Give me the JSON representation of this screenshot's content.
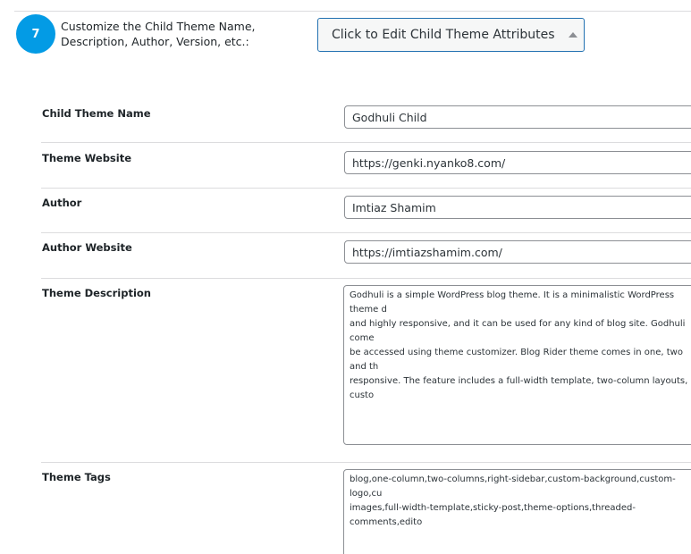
{
  "step": {
    "number": "7",
    "title": "Customize the Child Theme Name, Description, Author, Version, etc.:"
  },
  "toggle_button": {
    "label": "Click to Edit Child Theme Attributes",
    "icon": "caret-up-icon"
  },
  "fields": {
    "child_theme_name": {
      "label": "Child Theme Name",
      "value": "Godhuli Child"
    },
    "theme_website": {
      "label": "Theme Website",
      "value": "https://genki.nyanko8.com/"
    },
    "author": {
      "label": "Author",
      "value": "Imtiaz Shamim"
    },
    "author_website": {
      "label": "Author Website",
      "value": "https://imtiazshamim.com/"
    },
    "theme_description": {
      "label": "Theme Description",
      "value": "Godhuli is a simple WordPress blog theme. It is a minimalistic WordPress theme d\nand highly responsive, and it can be used for any kind of blog site. Godhuli come\nbe accessed using theme customizer. Blog Rider theme comes in one, two and th\nresponsive. The feature includes a full-width template, two-column layouts, custo"
    },
    "theme_tags": {
      "label": "Theme Tags",
      "value": "blog,one-column,two-columns,right-sidebar,custom-background,custom-logo,cu\nimages,full-width-template,sticky-post,theme-options,threaded-comments,edito"
    }
  },
  "colors": {
    "badge": "#039be5",
    "button_border": "#2271b1",
    "input_border": "#8c8f94",
    "separator": "#dcdcde"
  }
}
